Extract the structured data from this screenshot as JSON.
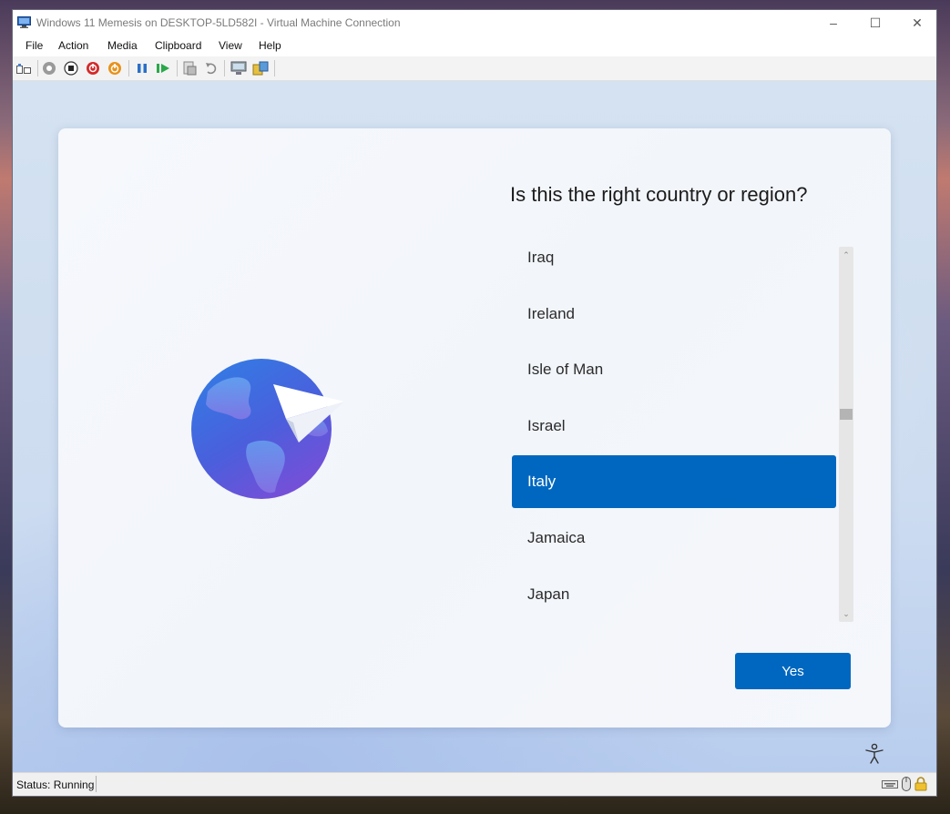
{
  "window": {
    "title": "Windows 11 Memesis on DESKTOP-5LD582I - Virtual Machine Connection",
    "controls": {
      "minimize": "–",
      "maximize": "☐",
      "close": "✕"
    }
  },
  "menu": [
    "File",
    "Action",
    "Media",
    "Clipboard",
    "View",
    "Help"
  ],
  "toolbar": {
    "icons": [
      "ctrl-alt-del-icon",
      "start-icon",
      "turn-off-icon",
      "shut-down-icon",
      "power-icon",
      "pause-icon",
      "resume-icon",
      "checkpoint-icon",
      "revert-icon",
      "enhanced-session-icon",
      "share-icon"
    ]
  },
  "oobe": {
    "question": "Is this the right country or region?",
    "countries": [
      "Iraq",
      "Ireland",
      "Isle of Man",
      "Israel",
      "Italy",
      "Jamaica",
      "Japan"
    ],
    "selected": "Italy",
    "scroll_position": 0.43,
    "yes_label": "Yes"
  },
  "status": {
    "text": "Status: Running",
    "icons": [
      "keyboard-icon",
      "mouse-icon",
      "lock-icon"
    ]
  },
  "colors": {
    "accent": "#0067c0",
    "globe_light": "#3d7ce0",
    "globe_dark": "#6a4fd6"
  }
}
